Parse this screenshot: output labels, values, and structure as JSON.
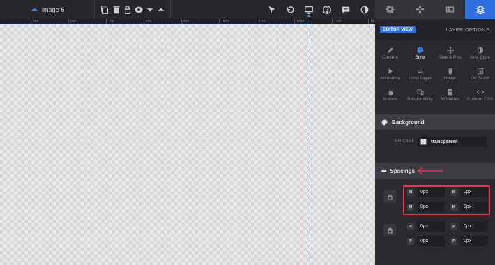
{
  "toolbar": {
    "layer_name": "image-6",
    "left_icons": [
      "copy-icon",
      "trash-icon",
      "lock-icon",
      "eye-icon",
      "caret-down-icon",
      "caret-up-icon"
    ],
    "right_icons": [
      "pointer-icon",
      "undo-icon",
      "desktop-icon",
      "help-icon",
      "chat-icon",
      "contrast-icon"
    ]
  },
  "panel_tabs": [
    "gear-icon",
    "gamepad-icon",
    "media-icon",
    "layers-icon"
  ],
  "ruler": {
    "ticks": [
      "500",
      "600",
      "700",
      "800",
      "900",
      "1000",
      "1100",
      "1200",
      "1300",
      "14"
    ]
  },
  "panel": {
    "editor_view": "EDITOR VIEW",
    "layer_options": "LAYER OPTIONS",
    "options": [
      {
        "label": "Content",
        "icon": "pencil-icon"
      },
      {
        "label": "Style",
        "icon": "palette-icon"
      },
      {
        "label": "Size & Pos",
        "icon": "move-icon"
      },
      {
        "label": "Adv. Style",
        "icon": "contrast-icon"
      },
      {
        "label": "Animation",
        "icon": "play-icon"
      },
      {
        "label": "Loop Layer",
        "icon": "loop-icon"
      },
      {
        "label": "Hover",
        "icon": "mouse-icon"
      },
      {
        "label": "On Scroll",
        "icon": "scroll-icon"
      },
      {
        "label": "Actions",
        "icon": "hand-icon"
      },
      {
        "label": "Responsivity",
        "icon": "responsive-icon"
      },
      {
        "label": "Attributes",
        "icon": "document-icon"
      },
      {
        "label": "Custom CSS",
        "icon": "code-icon"
      }
    ],
    "background": {
      "title": "Background",
      "bg_color_label": "BG Color",
      "bg_color_value": "transparent"
    },
    "spacings": {
      "title": "Spacings",
      "margin": [
        {
          "tag": "M",
          "value": "0px"
        },
        {
          "tag": "M",
          "value": "0px"
        },
        {
          "tag": "M",
          "value": "0px"
        },
        {
          "tag": "M",
          "value": "0px"
        }
      ],
      "padding": [
        {
          "tag": "P",
          "value": "0px"
        },
        {
          "tag": "P",
          "value": "0px"
        },
        {
          "tag": "P",
          "value": "0px"
        },
        {
          "tag": "P",
          "value": "0px"
        }
      ]
    }
  },
  "colors": {
    "accent": "#2f6fde",
    "highlight": "#e8344e",
    "panel_bg": "#292a2e"
  }
}
